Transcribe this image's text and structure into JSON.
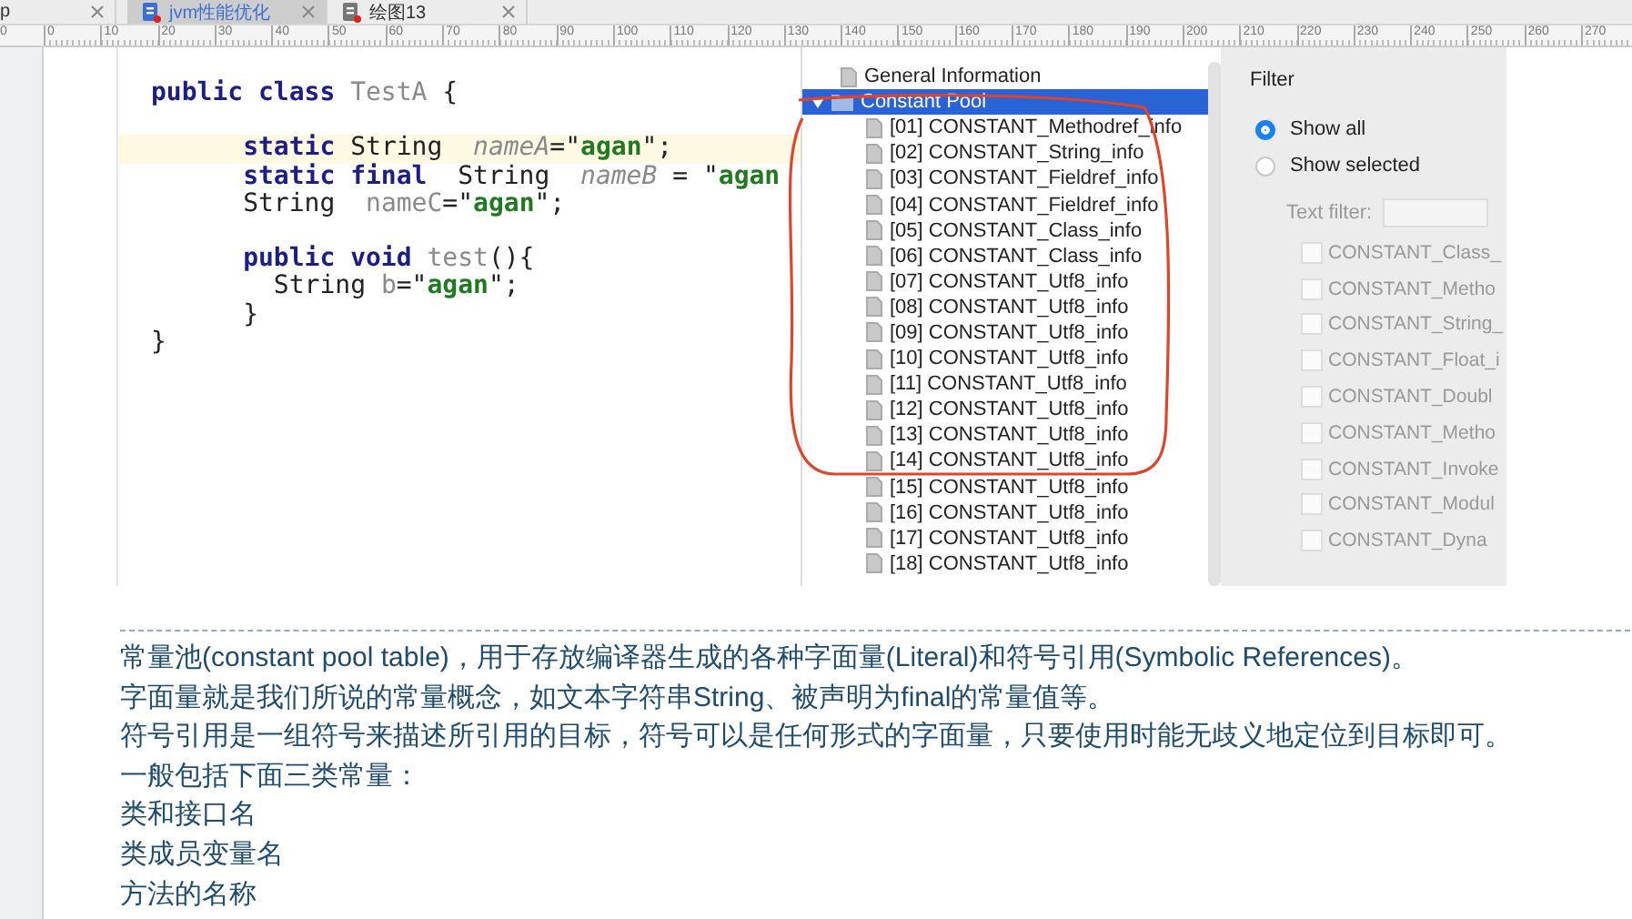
{
  "tabs": [
    {
      "label": "p",
      "selected": false,
      "has_icon": false
    },
    {
      "label": "jvm性能优化",
      "selected": true,
      "has_icon": true
    },
    {
      "label": "绘图13",
      "selected": false,
      "has_icon": true
    }
  ],
  "ruler": {
    "edge_label": "0",
    "labels": [
      "0",
      "10",
      "20",
      "30",
      "40",
      "50",
      "60",
      "70",
      "80",
      "90",
      "100",
      "110",
      "120",
      "130",
      "140",
      "150",
      "160",
      "170",
      "180",
      "190",
      "200",
      "210",
      "220",
      "230",
      "240",
      "250",
      "260",
      "270"
    ]
  },
  "code": {
    "lines": [
      {
        "gap_before": false,
        "highlighted": false,
        "tokens": [
          {
            "kind": "kw",
            "t": "public class "
          },
          {
            "kind": "cls",
            "t": "TestA"
          },
          {
            "kind": "plain",
            "t": " {"
          }
        ]
      },
      {
        "gap_before": true,
        "highlighted": true,
        "tokens": [
          {
            "kind": "kw",
            "t": "      static"
          },
          {
            "kind": "plain",
            "t": " String  "
          },
          {
            "kind": "field",
            "t": "nameA"
          },
          {
            "kind": "plain",
            "t": "=\""
          },
          {
            "kind": "str",
            "t": "agan"
          },
          {
            "kind": "plain",
            "t": "\";"
          }
        ]
      },
      {
        "gap_before": false,
        "highlighted": false,
        "tokens": [
          {
            "kind": "kw",
            "t": "      static final"
          },
          {
            "kind": "plain",
            "t": "  String  "
          },
          {
            "kind": "field",
            "t": "nameB"
          },
          {
            "kind": "plain",
            "t": " = \""
          },
          {
            "kind": "str",
            "t": "agan"
          }
        ]
      },
      {
        "gap_before": false,
        "highlighted": false,
        "tokens": [
          {
            "kind": "plain",
            "t": "      String  "
          },
          {
            "kind": "var",
            "t": "nameC"
          },
          {
            "kind": "plain",
            "t": "=\""
          },
          {
            "kind": "str",
            "t": "agan"
          },
          {
            "kind": "plain",
            "t": "\";"
          }
        ]
      },
      {
        "gap_before": true,
        "highlighted": false,
        "tokens": [
          {
            "kind": "kw",
            "t": "      public void "
          },
          {
            "kind": "var",
            "t": "test"
          },
          {
            "kind": "plain",
            "t": "(){"
          }
        ]
      },
      {
        "gap_before": false,
        "highlighted": false,
        "tokens": [
          {
            "kind": "plain",
            "t": "        String "
          },
          {
            "kind": "var",
            "t": "b"
          },
          {
            "kind": "plain",
            "t": "=\""
          },
          {
            "kind": "str",
            "t": "agan"
          },
          {
            "kind": "plain",
            "t": "\";"
          }
        ]
      },
      {
        "gap_before": false,
        "highlighted": false,
        "tokens": [
          {
            "kind": "plain",
            "t": "      }"
          }
        ]
      },
      {
        "gap_before": false,
        "highlighted": false,
        "tokens": [
          {
            "kind": "plain",
            "t": "}"
          }
        ]
      }
    ]
  },
  "tree": {
    "items": [
      {
        "label": "General Information",
        "kind": "leaf",
        "selected": false
      },
      {
        "label": "Constant Pool",
        "kind": "folder",
        "expanded": true,
        "selected": true,
        "children": [
          {
            "label": "[01] CONSTANT_Methodref_info",
            "kind": "leaf",
            "selected": false
          },
          {
            "label": "[02] CONSTANT_String_info",
            "kind": "leaf",
            "selected": false
          },
          {
            "label": "[03] CONSTANT_Fieldref_info",
            "kind": "leaf",
            "selected": false
          },
          {
            "label": "[04] CONSTANT_Fieldref_info",
            "kind": "leaf",
            "selected": false
          },
          {
            "label": "[05] CONSTANT_Class_info",
            "kind": "leaf",
            "selected": false
          },
          {
            "label": "[06] CONSTANT_Class_info",
            "kind": "leaf",
            "selected": false
          },
          {
            "label": "[07] CONSTANT_Utf8_info",
            "kind": "leaf",
            "selected": false
          },
          {
            "label": "[08] CONSTANT_Utf8_info",
            "kind": "leaf",
            "selected": false
          },
          {
            "label": "[09] CONSTANT_Utf8_info",
            "kind": "leaf",
            "selected": false
          },
          {
            "label": "[10] CONSTANT_Utf8_info",
            "kind": "leaf",
            "selected": false
          },
          {
            "label": "[11] CONSTANT_Utf8_info",
            "kind": "leaf",
            "selected": false
          },
          {
            "label": "[12] CONSTANT_Utf8_info",
            "kind": "leaf",
            "selected": false
          },
          {
            "label": "[13] CONSTANT_Utf8_info",
            "kind": "leaf",
            "selected": false
          },
          {
            "label": "[14] CONSTANT_Utf8_info",
            "kind": "leaf",
            "selected": false
          },
          {
            "label": "[15] CONSTANT_Utf8_info",
            "kind": "leaf",
            "selected": false
          },
          {
            "label": "[16] CONSTANT_Utf8_info",
            "kind": "leaf",
            "selected": false
          },
          {
            "label": "[17] CONSTANT_Utf8_info",
            "kind": "leaf",
            "selected": false
          },
          {
            "label": "[18] CONSTANT_Utf8_info",
            "kind": "leaf",
            "selected": false
          }
        ]
      }
    ]
  },
  "filter": {
    "title": "Filter",
    "options": [
      {
        "label": "Show all",
        "selected": true
      },
      {
        "label": "Show selected",
        "selected": false
      }
    ],
    "text_filter": {
      "label": "Text filter:",
      "disabled": true
    },
    "types": [
      {
        "label": "CONSTANT_Class_",
        "checked": false,
        "disabled": true
      },
      {
        "label": "CONSTANT_Metho",
        "checked": false,
        "disabled": true
      },
      {
        "label": "CONSTANT_String_",
        "checked": false,
        "disabled": true
      },
      {
        "label": "CONSTANT_Float_i",
        "checked": false,
        "disabled": true
      },
      {
        "label": "CONSTANT_Doubl",
        "checked": false,
        "disabled": true
      },
      {
        "label": "CONSTANT_Metho",
        "checked": false,
        "disabled": true
      },
      {
        "label": "CONSTANT_Invoke",
        "checked": false,
        "disabled": true
      },
      {
        "label": "CONSTANT_Modul",
        "checked": false,
        "disabled": true
      },
      {
        "label": "CONSTANT_Dyna",
        "checked": false,
        "disabled": true
      }
    ]
  },
  "notes": {
    "lines": [
      "常量池(constant pool table)，用于存放编译器生成的各种字面量(Literal)和符号引用(Symbolic References)。",
      "字面量就是我们所说的常量概念，如文本字符串String、被声明为final的常量值等。",
      "符号引用是一组符号来描述所引用的目标，符号可以是任何形式的字面量，只要使用时能无歧义地定位到目标即可。",
      "一般包括下面三类常量：",
      "类和接口名",
      "类成员变量名",
      "方法的名称"
    ]
  }
}
